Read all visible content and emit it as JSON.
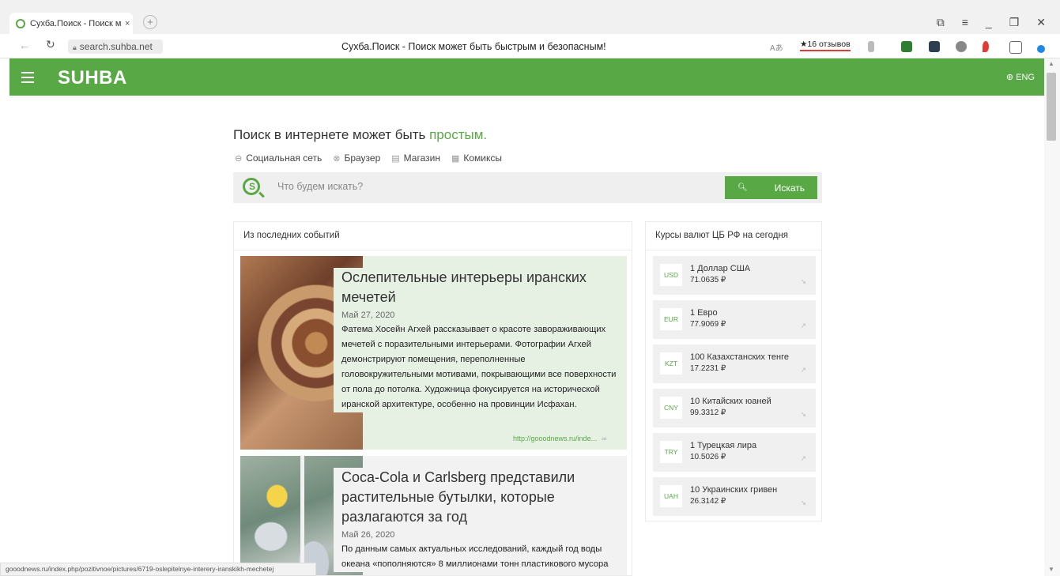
{
  "browser": {
    "tab_title": "Сухба.Поиск - Поиск м",
    "tab_close": "×",
    "new_tab": "+",
    "url": "search.suhba.net",
    "page_title": "Сухба.Поиск - Поиск может быть быстрым и безопасным!",
    "reviews_label": "★16 отзывов",
    "window_buttons": [
      "⧉",
      "≡",
      "_",
      "❐",
      "✕"
    ]
  },
  "header": {
    "logo": "SUHBA",
    "lang": "⊕ ENG"
  },
  "hero": {
    "tagline_prefix": "Поиск в интернете может быть ",
    "tagline_accent": "простым."
  },
  "service_links": [
    {
      "icon": "⊖",
      "label": "Социальная сеть"
    },
    {
      "icon": "⊗",
      "label": "Браузер"
    },
    {
      "icon": "▤",
      "label": "Магазин"
    },
    {
      "icon": "▦",
      "label": "Комиксы"
    }
  ],
  "search": {
    "logo_letter": "S",
    "placeholder": "Что будем искать?",
    "button_icon": "🔍︎",
    "button_label": "Искать"
  },
  "news": {
    "panel_title": "Из последних событий",
    "items": [
      {
        "title": "Ослепительные интерьеры иранских мечетей",
        "date": "Май 27, 2020",
        "body": "Фатема Хосейн Агхей рассказывает о красоте завораживающих мечетей с поразительными интерьерами. Фотографии Агхей демонстрируют помещения, переполненные головокружительными мотивами, покрывающими все поверхности от пола до потолка. Художница фокусируется на исторической иранской архитектуре, особенно на провинции Исфахан.",
        "source": "http://gooodnews.ru/inde..."
      },
      {
        "title": "Coca-Cola и Carlsberg представили растительные бутылки, которые разлагаются за год",
        "date": "Май 26, 2020",
        "body": "По данным самых актуальных исследований, каждый год воды океана «пополняются» 8 миллионами тонн пластикового мусора"
      }
    ]
  },
  "rates": {
    "panel_title": "Курсы валют ЦБ РФ на сегодня",
    "items": [
      {
        "code": "USD",
        "name": "1 Доллар США",
        "value": "71.0635 ₽",
        "trend": "down"
      },
      {
        "code": "EUR",
        "name": "1 Евро",
        "value": "77.9069 ₽",
        "trend": "up"
      },
      {
        "code": "KZT",
        "name": "100 Казахстанских тенге",
        "value": "17.2231 ₽",
        "trend": "up"
      },
      {
        "code": "CNY",
        "name": "10 Китайских юаней",
        "value": "99.3312 ₽",
        "trend": "down"
      },
      {
        "code": "TRY",
        "name": "1 Турецкая лира",
        "value": "10.5026 ₽",
        "trend": "up"
      },
      {
        "code": "UAH",
        "name": "10 Украинских гривен",
        "value": "26.3142 ₽",
        "trend": "down"
      }
    ]
  },
  "status_bar": {
    "url": "gooodnews.ru/index.php/pozitivnoe/pictures/6719-oslepitelnye-interery-iranskikh-mechetej"
  }
}
